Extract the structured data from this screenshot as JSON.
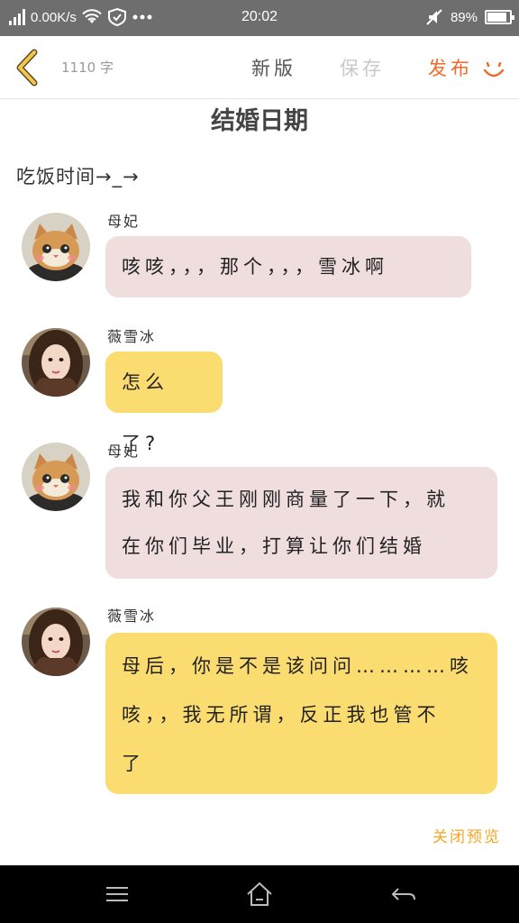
{
  "status": {
    "speed": "0.00K/s",
    "time": "20:02",
    "battery": "89%",
    "battery_level": 0.89,
    "icons": [
      "signal-icon",
      "wifi-icon",
      "shield-icon",
      "more-icon",
      "mute-icon",
      "battery-icon"
    ]
  },
  "toolbar": {
    "word_count": "1110 字",
    "new_label": "新版",
    "save_label": "保存",
    "publish_label": "发布",
    "accent": "#f06a2c"
  },
  "document": {
    "title": "结婚日期",
    "subtitle": "吃饭时间→_→"
  },
  "messages": [
    {
      "name": "母妃",
      "text_lines": [
        "咳咳，，，那个，，，雪冰啊"
      ],
      "color": "pink"
    },
    {
      "name": "薇雪冰",
      "text_lines": [
        "怎么了?"
      ],
      "color": "yellow"
    },
    {
      "name": "母妃",
      "text_lines": [
        "我和你父王刚刚商量了一下，就",
        "在你们毕业，打算让你们结婚"
      ],
      "color": "pink"
    },
    {
      "name": "薇雪冰",
      "text_lines": [
        "母后，你是不是该问问…………咳",
        "咳，，我无所谓，反正我也管不",
        "了"
      ],
      "color": "yellow"
    }
  ],
  "footer": {
    "close_preview": "关闭预览"
  },
  "colors": {
    "pink_bubble": "#f0dedf",
    "yellow_bubble": "#fbdc70",
    "status_bar": "#6e6e6e"
  }
}
